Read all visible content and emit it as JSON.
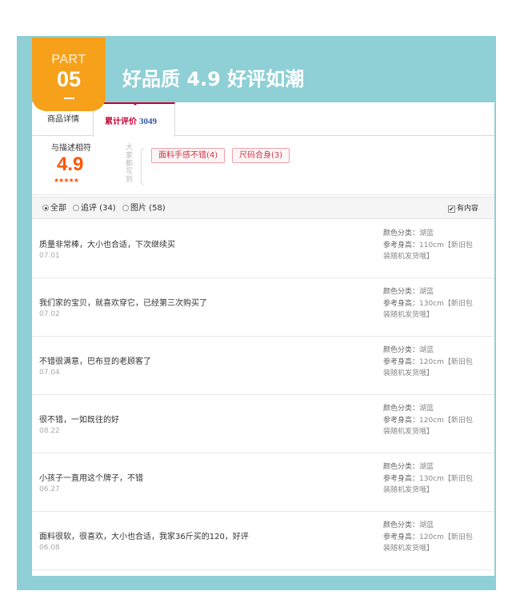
{
  "badge": {
    "part": "PART",
    "number": "05"
  },
  "headline": "好品质 4.9 好评如潮",
  "tabs": {
    "detail": "商品详情",
    "review_label": "累计评价",
    "review_count": "3049"
  },
  "summary": {
    "rate_label": "与描述相符",
    "rate_score": "4.9",
    "rate_stars": "★★★★★",
    "impression_label": "大家都写到",
    "tags": [
      {
        "label": "面料手感不错(4)"
      },
      {
        "label": "尺码合身(3)"
      }
    ]
  },
  "filter": {
    "all": "全部",
    "append": "追评 (34)",
    "pictures": "图片 (58)",
    "has_content": "有内容"
  },
  "reviews": [
    {
      "comment": "质量非常棒，大小也合适，下次继续买",
      "date": "07.01",
      "color_key": "颜色分类：",
      "color": "湖蓝",
      "height_key": "参考身高：",
      "height": "110cm【新旧包装随机发货哦】"
    },
    {
      "comment": "我们家的宝贝，就喜欢穿它，已经第三次购买了",
      "date": "07.02",
      "color_key": "颜色分类：",
      "color": "湖蓝",
      "height_key": "参考身高：",
      "height": "130cm【新旧包装随机发货哦】"
    },
    {
      "comment": "不错很满意，巴布豆的老顾客了",
      "date": "07.04",
      "color_key": "颜色分类：",
      "color": "湖蓝",
      "height_key": "参考身高：",
      "height": "120cm【新旧包装随机发货哦】"
    },
    {
      "comment": "很不错，一如既往的好",
      "date": "08.22",
      "color_key": "颜色分类：",
      "color": "湖蓝",
      "height_key": "参考身高：",
      "height": "120cm【新旧包装随机发货哦】"
    },
    {
      "comment": "小孩子一直用这个牌子，不错",
      "date": "06.27",
      "color_key": "颜色分类：",
      "color": "湖蓝",
      "height_key": "参考身高：",
      "height": "130cm【新旧包装随机发货哦】"
    },
    {
      "comment": "面料很软，很喜欢，大小也合适，我家36斤买的120，好评",
      "date": "06.08",
      "color_key": "颜色分类：",
      "color": "湖蓝",
      "height_key": "参考身高：",
      "height": "120cm【新旧包装随机发货哦】"
    }
  ]
}
